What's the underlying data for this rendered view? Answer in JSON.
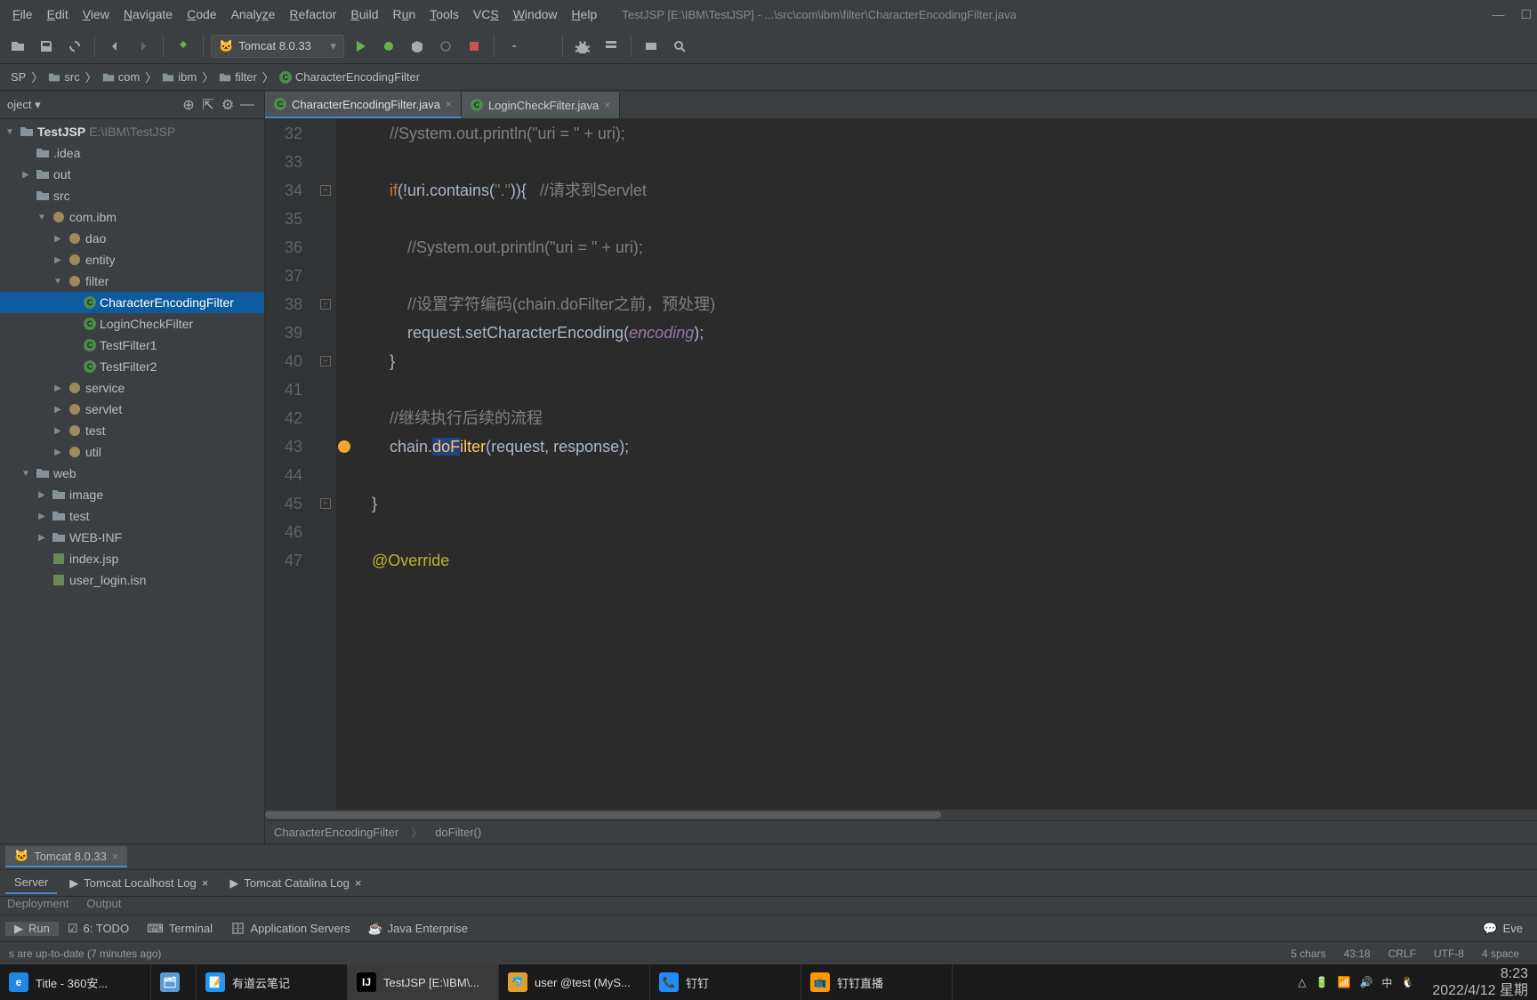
{
  "menu": {
    "items": [
      "File",
      "Edit",
      "View",
      "Navigate",
      "Code",
      "Analyze",
      "Refactor",
      "Build",
      "Run",
      "Tools",
      "VCS",
      "Window",
      "Help"
    ]
  },
  "windowTitle": "TestJSP [E:\\IBM\\TestJSP] - ...\\src\\com\\ibm\\filter\\CharacterEncodingFilter.java",
  "runConfig": "Tomcat 8.0.33",
  "breadcrumb": [
    "SP",
    "src",
    "com",
    "ibm",
    "filter",
    "CharacterEncodingFilter"
  ],
  "sidebar": {
    "title": "oject",
    "rootName": "TestJSP",
    "rootPath": "E:\\IBM\\TestJSP",
    "nodes": [
      {
        "depth": 1,
        "arrow": "",
        "kind": "dir",
        "label": ".idea"
      },
      {
        "depth": 1,
        "arrow": "▶",
        "kind": "dir",
        "label": "out"
      },
      {
        "depth": 1,
        "arrow": "",
        "kind": "dir",
        "label": "src"
      },
      {
        "depth": 2,
        "arrow": "▼",
        "kind": "pkg",
        "label": "com.ibm"
      },
      {
        "depth": 3,
        "arrow": "▶",
        "kind": "pkg",
        "label": "dao"
      },
      {
        "depth": 3,
        "arrow": "▶",
        "kind": "pkg",
        "label": "entity"
      },
      {
        "depth": 3,
        "arrow": "▼",
        "kind": "pkg",
        "label": "filter"
      },
      {
        "depth": 4,
        "arrow": "",
        "kind": "class",
        "label": "CharacterEncodingFilter",
        "sel": true
      },
      {
        "depth": 4,
        "arrow": "",
        "kind": "class",
        "label": "LoginCheckFilter"
      },
      {
        "depth": 4,
        "arrow": "",
        "kind": "class",
        "label": "TestFilter1"
      },
      {
        "depth": 4,
        "arrow": "",
        "kind": "class",
        "label": "TestFilter2"
      },
      {
        "depth": 3,
        "arrow": "▶",
        "kind": "pkg",
        "label": "service"
      },
      {
        "depth": 3,
        "arrow": "▶",
        "kind": "pkg",
        "label": "servlet"
      },
      {
        "depth": 3,
        "arrow": "▶",
        "kind": "pkg",
        "label": "test"
      },
      {
        "depth": 3,
        "arrow": "▶",
        "kind": "pkg",
        "label": "util"
      },
      {
        "depth": 1,
        "arrow": "▼",
        "kind": "dir",
        "label": "web"
      },
      {
        "depth": 2,
        "arrow": "▶",
        "kind": "dir",
        "label": "image"
      },
      {
        "depth": 2,
        "arrow": "▶",
        "kind": "dir",
        "label": "test"
      },
      {
        "depth": 2,
        "arrow": "▶",
        "kind": "dir",
        "label": "WEB-INF"
      },
      {
        "depth": 2,
        "arrow": "",
        "kind": "jsp",
        "label": "index.jsp"
      },
      {
        "depth": 2,
        "arrow": "",
        "kind": "jsp",
        "label": "user_login.isn"
      }
    ]
  },
  "editor": {
    "tabs": [
      {
        "label": "CharacterEncodingFilter.java",
        "active": true
      },
      {
        "label": "LoginCheckFilter.java",
        "active": false
      }
    ],
    "code": {
      "start": 32,
      "lines": [
        {
          "n": 32,
          "html": "        <span class='c-cm'>//System.out.println(\"uri = \" + uri);</span>"
        },
        {
          "n": 33,
          "html": ""
        },
        {
          "n": 34,
          "html": "        <span class='c-kw'>if</span><span class='c-id'>(!uri.contains(</span><span class='c-str'>\".\"</span><span class='c-id'>)){   </span><span class='c-cm'>//请求到Servlet</span>"
        },
        {
          "n": 35,
          "html": ""
        },
        {
          "n": 36,
          "html": "            <span class='c-cm'>//System.out.println(\"uri = \" + uri);</span>"
        },
        {
          "n": 37,
          "html": ""
        },
        {
          "n": 38,
          "html": "            <span class='c-cm'>//设置字符编码(chain.doFilter之前，预处理)</span>"
        },
        {
          "n": 39,
          "html": "            <span class='c-id'>request.setCharacterEncoding(</span><span class='c-var'>encoding</span><span class='c-id'>);</span>"
        },
        {
          "n": 40,
          "html": "        <span class='c-id'>}</span>"
        },
        {
          "n": 41,
          "html": ""
        },
        {
          "n": 42,
          "html": "        <span class='c-cm'>//继续执行后续的流程</span>"
        },
        {
          "n": 43,
          "html": "        <span class='c-id'>chain</span><span class='c-id'>.</span><span class='sel-highlight c-fn'>doF</span><span class='c-fn'>ilter</span><span class='c-id'>(request, response);</span>",
          "bulb": true
        },
        {
          "n": 44,
          "html": ""
        },
        {
          "n": 45,
          "html": "    <span class='c-id'>}</span>"
        },
        {
          "n": 46,
          "html": ""
        },
        {
          "n": 47,
          "html": "    <span class='c-ann'>@Override</span>"
        }
      ]
    },
    "crumb": [
      "CharacterEncodingFilter",
      "doFilter()"
    ]
  },
  "runPanel": {
    "tab": "Tomcat 8.0.33",
    "subtabs": [
      {
        "label": "Server",
        "active": true
      },
      {
        "label": "Tomcat Localhost Log",
        "active": false,
        "close": true
      },
      {
        "label": "Tomcat Catalina Log",
        "active": false,
        "close": true
      }
    ],
    "belowTabs": [
      "Deployment",
      "Output"
    ]
  },
  "bottomBar": {
    "items": [
      "Run",
      "6: TODO",
      "Terminal",
      "Application Servers",
      "Java Enterprise"
    ],
    "right": "Eve"
  },
  "status": {
    "msg": "s are up-to-date (7 minutes ago)",
    "chars": "5 chars",
    "pos": "43:18",
    "sep": "CRLF",
    "enc": "UTF-8",
    "indent": "4 space"
  },
  "taskbar": {
    "items": [
      {
        "label": "Title - 360安...",
        "color": "#1e88e5",
        "initial": "e"
      },
      {
        "label": "",
        "color": "#5a9bd4",
        "initial": "🗂"
      },
      {
        "label": "有道云笔记",
        "color": "#2196f3",
        "initial": "📝"
      },
      {
        "label": "TestJSP [E:\\IBM\\...",
        "color": "#000",
        "initial": "IJ",
        "active": true
      },
      {
        "label": "user @test (MyS...",
        "color": "#e0a030",
        "initial": "🐬"
      },
      {
        "label": "钉钉",
        "color": "#208cff",
        "initial": "📞"
      },
      {
        "label": "钉钉直播",
        "color": "#ff9800",
        "initial": "📺"
      }
    ],
    "ime": "中",
    "time": "8:23",
    "date": "2022/4/12 星期"
  }
}
